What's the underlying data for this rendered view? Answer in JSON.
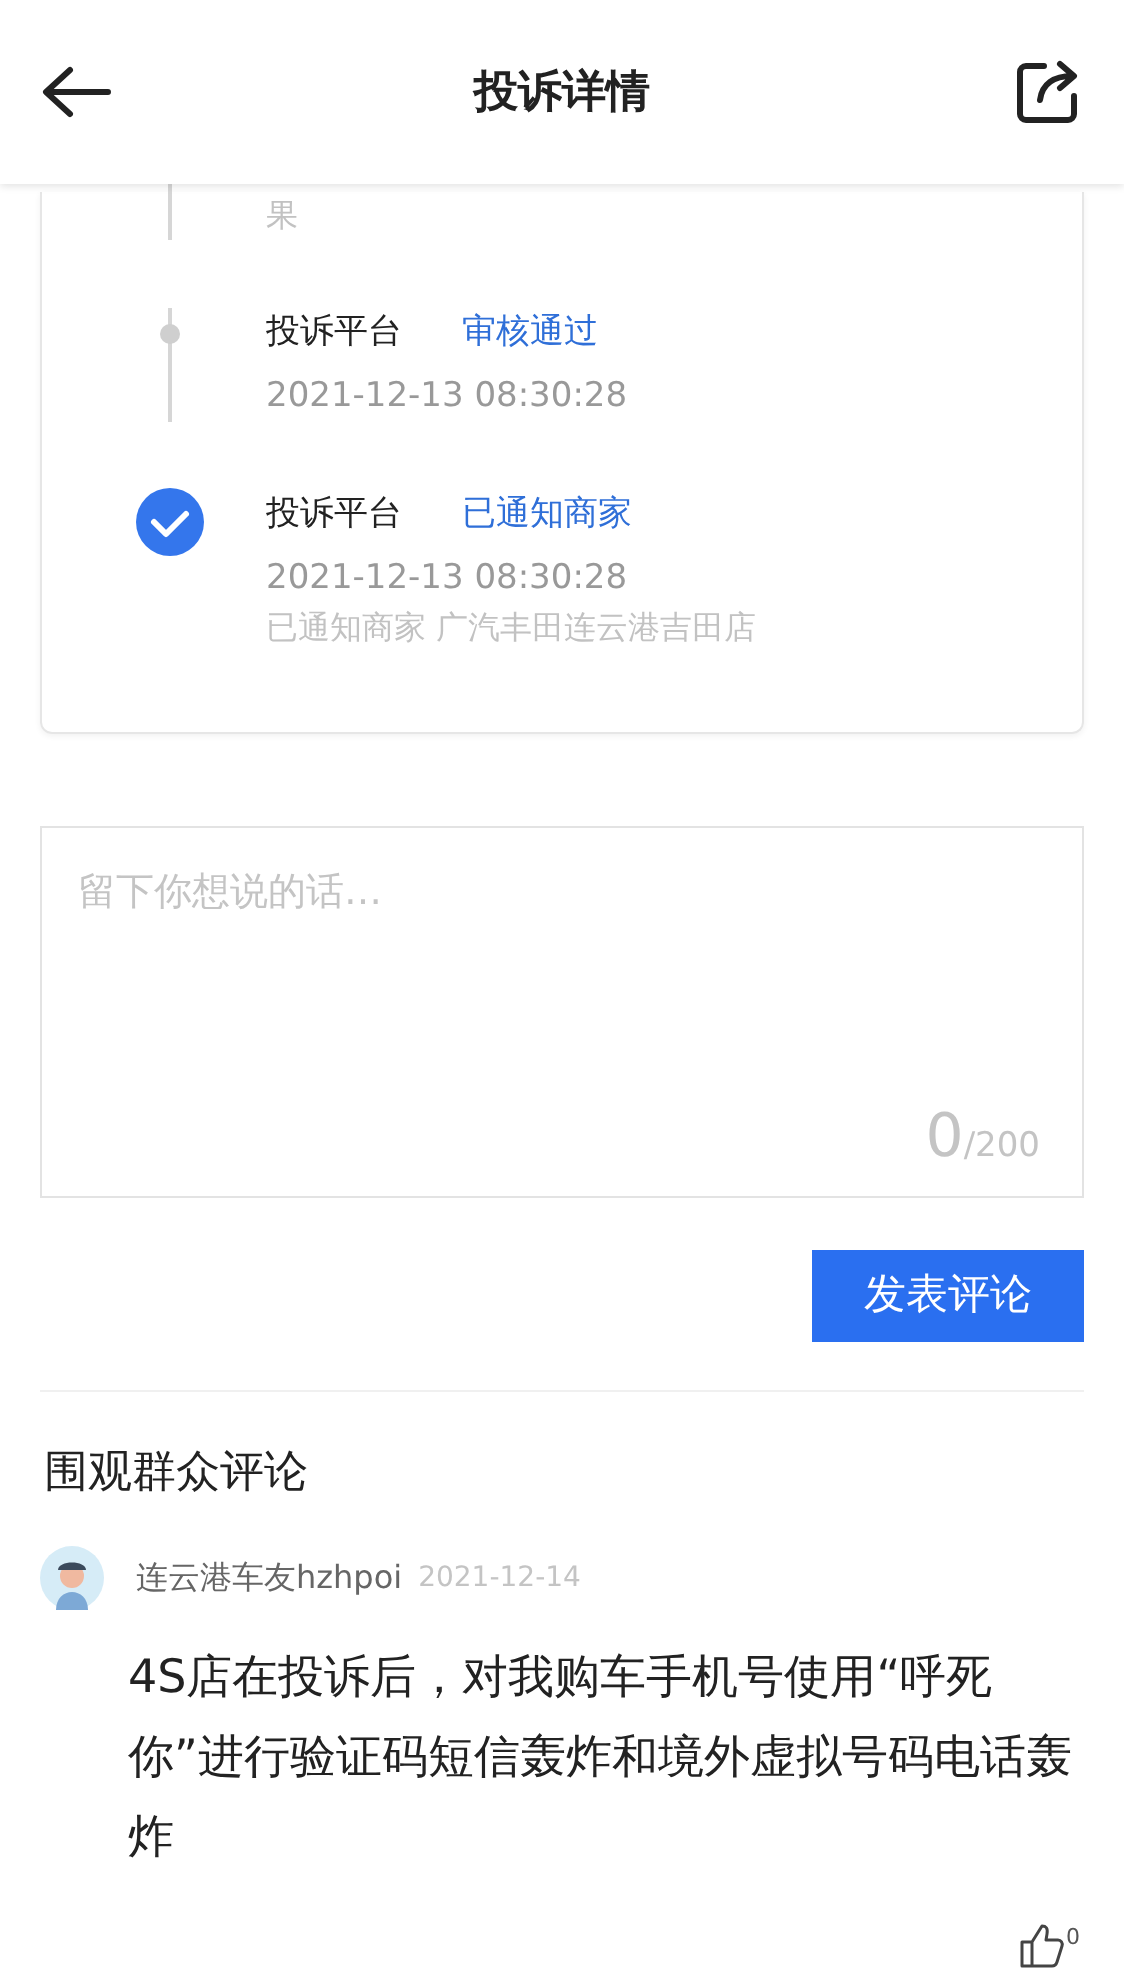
{
  "header": {
    "title": "投诉详情"
  },
  "timeline": [
    {
      "kind": "tail",
      "note": "果"
    },
    {
      "kind": "dot",
      "actor": "投诉平台",
      "status": "审核通过",
      "time": "2021-12-13 08:30:28"
    },
    {
      "kind": "check",
      "actor": "投诉平台",
      "status": "已通知商家",
      "time": "2021-12-13 08:30:28",
      "note": "已通知商家 广汽丰田连云港吉田店"
    }
  ],
  "comment_box": {
    "placeholder": "留下你想说的话…",
    "count": "0",
    "limit": "/200"
  },
  "submit_button": "发表评论",
  "comments_section": {
    "title": "围观群众评论",
    "comments": [
      {
        "user": "连云港车友hzhpoi",
        "date": "2021-12-14",
        "text": "4S店在投诉后，对我购车手机号使用“呼死你”进行验证码短信轰炸和境外虚拟号码电话轰炸",
        "likes": "0"
      }
    ]
  }
}
